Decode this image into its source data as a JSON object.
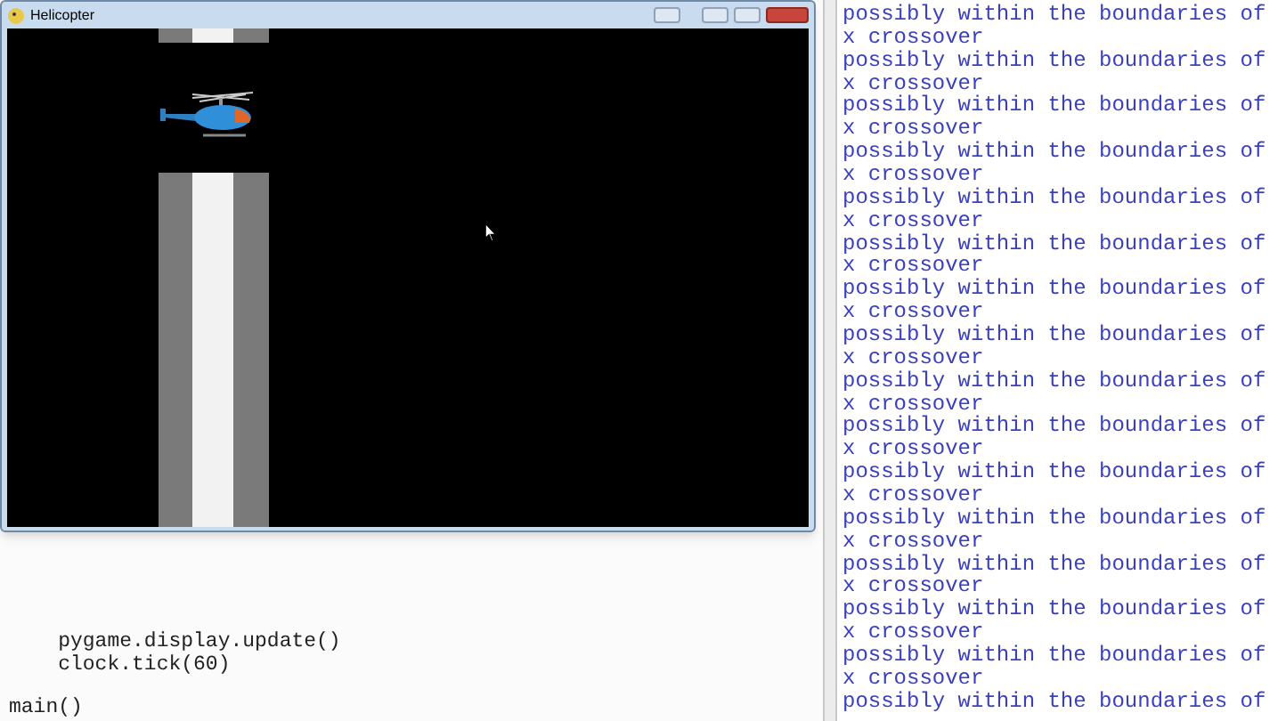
{
  "game_window": {
    "title": "Helicopter"
  },
  "editor": {
    "lines": [
      "    pygame.display.update()",
      "    clock.tick(60)",
      "main()"
    ]
  },
  "output": {
    "lines": [
      "possibly within the boundaries of",
      "x crossover",
      "possibly within the boundaries of",
      "x crossover",
      "possibly within the boundaries of",
      "x crossover",
      "possibly within the boundaries of",
      "x crossover",
      "possibly within the boundaries of",
      "x crossover",
      "possibly within the boundaries of",
      "x crossover",
      "possibly within the boundaries of",
      "x crossover",
      "possibly within the boundaries of",
      "x crossover",
      "possibly within the boundaries of",
      "x crossover",
      "possibly within the boundaries of",
      "x crossover",
      "possibly within the boundaries of",
      "x crossover",
      "possibly within the boundaries of",
      "x crossover",
      "possibly within the boundaries of",
      "x crossover",
      "possibly within the boundaries of",
      "x crossover",
      "possibly within the boundaries of",
      "x crossover",
      "possibly within the boundaries of"
    ]
  }
}
